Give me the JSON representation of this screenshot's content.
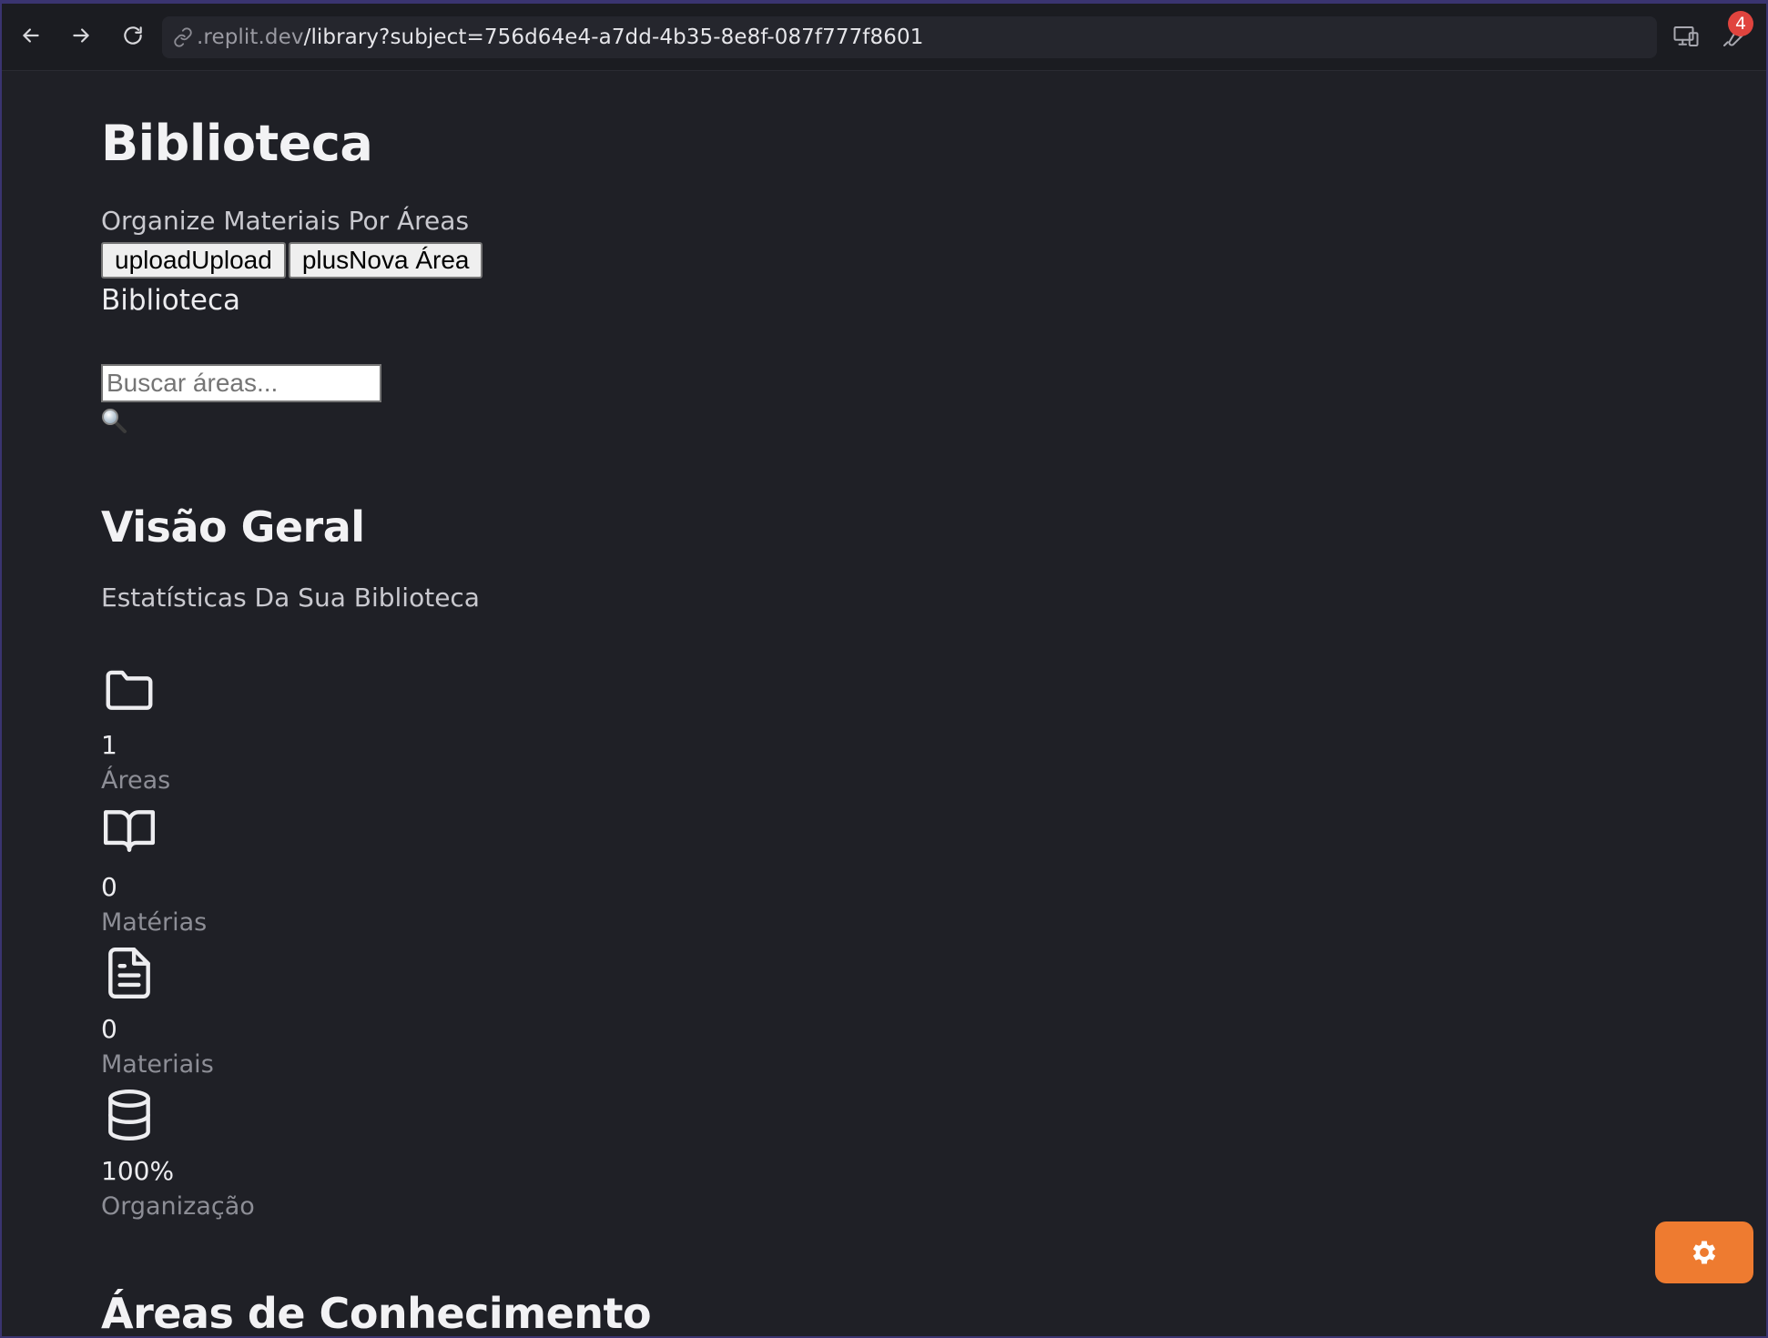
{
  "browser": {
    "url_domain": ".replit.dev",
    "url_path": "/library?subject=756d64e4-a7dd-4b35-8e8f-087f777f8601",
    "notification_count": "4",
    "icons": {
      "back": "arrow-left-icon",
      "forward": "arrow-right-icon",
      "reload": "reload-icon",
      "link": "link-icon",
      "devices": "devices-icon",
      "tools": "wrench-icon"
    }
  },
  "page": {
    "title": "Biblioteca",
    "subtitle": "Organize Materiais Por Áreas",
    "buttons": {
      "upload": "uploadUpload",
      "new_area": "plusNova Área"
    },
    "section_label": "Biblioteca",
    "search": {
      "placeholder": "Buscar áreas...",
      "value": "",
      "icon": "magnifier-icon"
    }
  },
  "overview": {
    "title": "Visão Geral",
    "description": "Estatísticas Da Sua Biblioteca",
    "stats": [
      {
        "icon": "folder-icon",
        "value": "1",
        "label": "Áreas"
      },
      {
        "icon": "book-open-icon",
        "value": "0",
        "label": "Matérias"
      },
      {
        "icon": "file-text-icon",
        "value": "0",
        "label": "Materiais"
      },
      {
        "icon": "database-icon",
        "value": "100%",
        "label": "Organização"
      }
    ]
  },
  "areas_section": {
    "title": "Áreas de Conhecimento"
  },
  "fab": {
    "icon": "gear-icon",
    "color": "#ee7b30"
  }
}
